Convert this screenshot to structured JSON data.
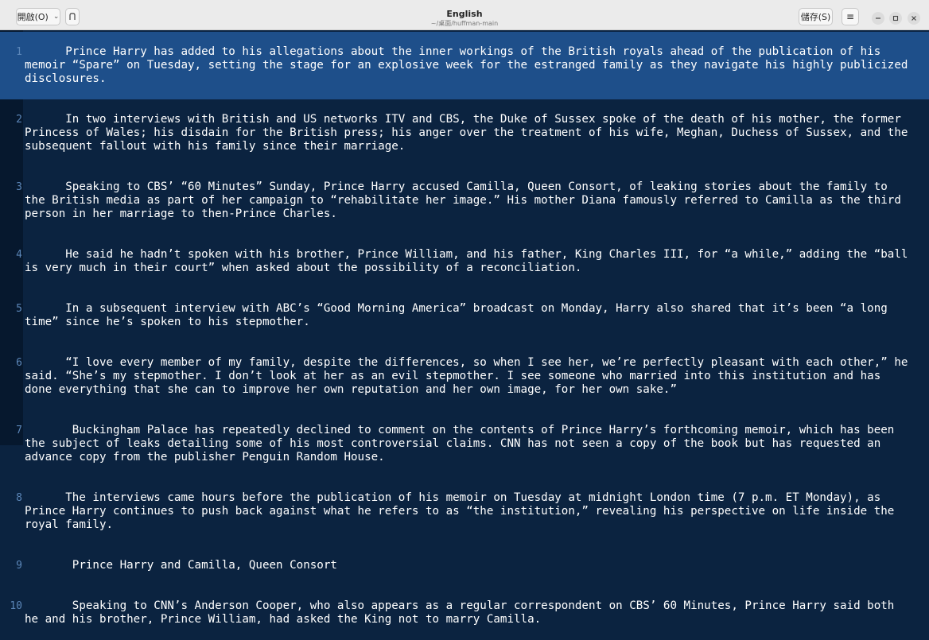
{
  "window": {
    "title": "English",
    "path": "~/桌面/huffman-main",
    "open_label": "開啟(O)",
    "save_label": "儲存(S)"
  },
  "icons": {
    "open_dropdown": "chevron-down-icon",
    "new_tab": "new-tab-icon",
    "menu": "hamburger-menu-icon",
    "minimize": "minimize-icon",
    "maximize": "maximize-icon",
    "close": "close-icon"
  },
  "colors": {
    "background": "#0b2340",
    "current_line": "#1e4f8a",
    "line_number": "#5b86b8",
    "text": "#ffffff"
  },
  "editor": {
    "current_line": 1,
    "lines": [
      {
        "num": "1",
        "text": "Prince Harry has added to his allegations about the inner workings of the British royals ahead of the publication of his memoir “Spare” on Tuesday, setting the stage for an explosive week for the estranged family as they navigate his highly publicized disclosures."
      },
      {
        "num": "2",
        "text": "In two interviews with British and US networks ITV and CBS, the Duke of Sussex spoke of the death of his mother, the former Princess of Wales; his disdain for the British press; his anger over the treatment of his wife, Meghan, Duchess of Sussex, and the subsequent fallout with his family since their marriage."
      },
      {
        "num": "3",
        "text": "Speaking to CBS’ “60 Minutes” Sunday, Prince Harry accused Camilla, Queen Consort, of leaking stories about the family to the British media as part of her campaign to “rehabilitate her image.” His mother Diana famously referred to Camilla as the third person in her marriage to then-Prince Charles."
      },
      {
        "num": "4",
        "text": "He said he hadn’t spoken with his brother, Prince William, and his father, King Charles III, for “a while,” adding the “ball is very much in their court” when asked about the possibility of a reconciliation."
      },
      {
        "num": "5",
        "text": "In a subsequent interview with ABC’s “Good Morning America” broadcast on Monday, Harry also shared that it’s been “a long time” since he’s spoken to his stepmother."
      },
      {
        "num": "6",
        "text": "“I love every member of my family, despite the differences, so when I see her, we’re perfectly pleasant with each other,” he said. “She’s my stepmother. I don’t look at her as an evil stepmother. I see someone who married into this institution and has done everything that she can to improve her own reputation and her own image, for her own sake.”"
      },
      {
        "num": "7",
        "text": " Buckingham Palace has repeatedly declined to comment on the contents of Prince Harry’s forthcoming memoir, which has been the subject of leaks detailing some of his most controversial claims. CNN has not seen a copy of the book but has requested an advance copy from the publisher Penguin Random House."
      },
      {
        "num": "8",
        "text": "The interviews came hours before the publication of his memoir on Tuesday at midnight London time (7 p.m. ET Monday), as Prince Harry continues to push back against what he refers to as “the institution,” revealing his perspective on life inside the royal family."
      },
      {
        "num": "9",
        "text": " Prince Harry and Camilla, Queen Consort"
      },
      {
        "num": "10",
        "text": " Speaking to CNN’s Anderson Cooper, who also appears as a regular correspondent on CBS’ 60 Minutes, Prince Harry said both he and his brother, Prince William, had asked the King not to marry Camilla."
      }
    ]
  }
}
